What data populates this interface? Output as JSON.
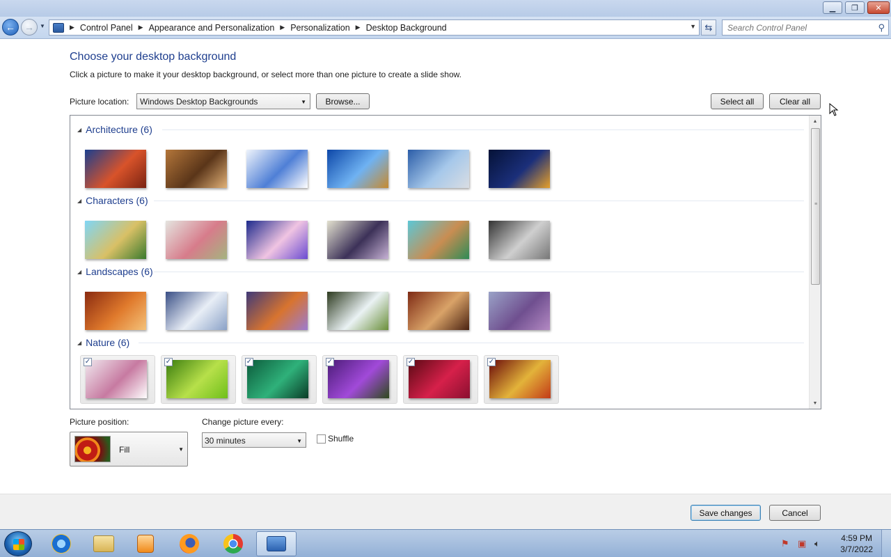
{
  "window": {
    "caption_buttons": [
      "minimize",
      "maximize",
      "close"
    ]
  },
  "nav": {
    "breadcrumbs": [
      "Control Panel",
      "Appearance and Personalization",
      "Personalization",
      "Desktop Background"
    ],
    "search_placeholder": "Search Control Panel"
  },
  "main": {
    "heading": "Choose your desktop background",
    "subtext": "Click a picture to make it your desktop background, or select more than one picture to create a slide show.",
    "location_label": "Picture location:",
    "location_value": "Windows Desktop Backgrounds",
    "browse_label": "Browse...",
    "select_all_label": "Select all",
    "clear_all_label": "Clear all"
  },
  "groups": [
    {
      "name": "Architecture (6)",
      "selected": false,
      "thumbs": [
        {
          "c1": "#1b3f8f",
          "c2": "#d8532a",
          "c3": "#7a2312"
        },
        {
          "c1": "#b3763a",
          "c2": "#5a3519",
          "c3": "#e1b177"
        },
        {
          "c1": "#eef3fb",
          "c2": "#4f7fd6",
          "c3": "#ffffff"
        },
        {
          "c1": "#0d47a8",
          "c2": "#6fb2f2",
          "c3": "#c78a2f"
        },
        {
          "c1": "#2b5da8",
          "c2": "#a6c8ea",
          "c3": "#d9dde3"
        },
        {
          "c1": "#051237",
          "c2": "#1b2f7a",
          "c3": "#e6a02a"
        }
      ]
    },
    {
      "name": "Characters (6)",
      "selected": false,
      "thumbs": [
        {
          "c1": "#7fd6f6",
          "c2": "#d9c066",
          "c3": "#3a7a2e"
        },
        {
          "c1": "#e4e4df",
          "c2": "#d77c8b",
          "c3": "#a4b47f"
        },
        {
          "c1": "#1d2a8c",
          "c2": "#f0c4e2",
          "c3": "#6a4bd1"
        },
        {
          "c1": "#e3e1cf",
          "c2": "#3c3158",
          "c3": "#c7b2d5"
        },
        {
          "c1": "#5cc7d6",
          "c2": "#c98d52",
          "c3": "#2e8b57"
        },
        {
          "c1": "#333333",
          "c2": "#cfcfcf",
          "c3": "#777777"
        }
      ]
    },
    {
      "name": "Landscapes (6)",
      "selected": false,
      "thumbs": [
        {
          "c1": "#8a2b10",
          "c2": "#e07a2c",
          "c3": "#f4c27a"
        },
        {
          "c1": "#3a4f86",
          "c2": "#e8eef6",
          "c3": "#8aa1c7"
        },
        {
          "c1": "#403a78",
          "c2": "#d8742f",
          "c3": "#9b7bd0"
        },
        {
          "c1": "#2d3a1f",
          "c2": "#eaf2f4",
          "c3": "#6b8f3a"
        },
        {
          "c1": "#7e2a14",
          "c2": "#d9a368",
          "c3": "#4a2211"
        },
        {
          "c1": "#9aa2c7",
          "c2": "#6f4f8f",
          "c3": "#b389c3"
        }
      ]
    },
    {
      "name": "Nature (6)",
      "selected": true,
      "thumbs": [
        {
          "c1": "#f0e8ee",
          "c2": "#c77aa1",
          "c3": "#fefefe"
        },
        {
          "c1": "#3b7d0f",
          "c2": "#b7e04a",
          "c3": "#6fbf1a"
        },
        {
          "c1": "#0c5b3b",
          "c2": "#2fb17a",
          "c3": "#0a3b26"
        },
        {
          "c1": "#4b1c78",
          "c2": "#a14ad9",
          "c3": "#2e4a1c"
        },
        {
          "c1": "#5a0a14",
          "c2": "#d6204a",
          "c3": "#8a1030"
        },
        {
          "c1": "#6a0a0a",
          "c2": "#e3b33a",
          "c3": "#c23a18"
        }
      ]
    }
  ],
  "options": {
    "position_label": "Picture position:",
    "position_value": "Fill",
    "change_label": "Change picture every:",
    "change_value": "30 minutes",
    "shuffle_label": "Shuffle",
    "shuffle_checked": false
  },
  "footer": {
    "save_label": "Save changes",
    "cancel_label": "Cancel"
  },
  "taskbar": {
    "apps": [
      "internet-explorer-icon",
      "file-explorer-icon",
      "media-player-icon",
      "firefox-icon",
      "chrome-icon",
      "control-panel-icon"
    ],
    "time": "4:59 PM",
    "date": "3/7/2022"
  }
}
